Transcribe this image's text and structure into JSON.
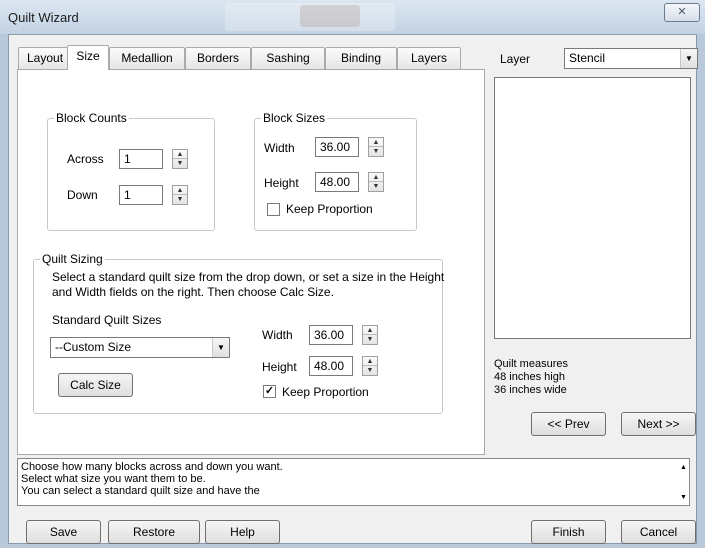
{
  "window": {
    "title": "Quilt Wizard",
    "close_glyph": "✕"
  },
  "tabs": [
    {
      "label": "Layout"
    },
    {
      "label": "Size",
      "active": true
    },
    {
      "label": "Medallion"
    },
    {
      "label": "Borders"
    },
    {
      "label": "Sashing"
    },
    {
      "label": "Binding"
    },
    {
      "label": "Layers"
    }
  ],
  "block_counts": {
    "title": "Block Counts",
    "across_label": "Across",
    "across_value": "1",
    "down_label": "Down",
    "down_value": "1"
  },
  "block_sizes": {
    "title": "Block Sizes",
    "width_label": "Width",
    "width_value": "36.00",
    "height_label": "Height",
    "height_value": "48.00",
    "keep_proportion_label": "Keep Proportion",
    "keep_proportion_checked": false
  },
  "quilt_sizing": {
    "title": "Quilt Sizing",
    "description_line1": "Select a standard quilt size from the drop down, or set a size in the Height",
    "description_line2": "and Width fields on the right. Then choose Calc Size.",
    "standard_sizes_label": "Standard Quilt Sizes",
    "standard_size_selected": "--Custom Size",
    "width_label": "Width",
    "width_value": "36.00",
    "height_label": "Height",
    "height_value": "48.00",
    "keep_proportion_label": "Keep Proportion",
    "keep_proportion_checked": true,
    "calc_size_button": "Calc Size"
  },
  "layer": {
    "label": "Layer",
    "selected": "Stencil"
  },
  "measures": {
    "line1": "Quilt measures",
    "line2": "48 inches high",
    "line3": "36 inches wide"
  },
  "nav": {
    "prev": "<< Prev",
    "next": "Next >>"
  },
  "status": {
    "line1": "Choose how many blocks across and down you want.",
    "line2": "Select what size you want them to be.",
    "line3": "You can select a standard quilt size and have the"
  },
  "footer": {
    "save": "Save",
    "restore": "Restore",
    "help": "Help",
    "finish": "Finish",
    "cancel": "Cancel"
  }
}
